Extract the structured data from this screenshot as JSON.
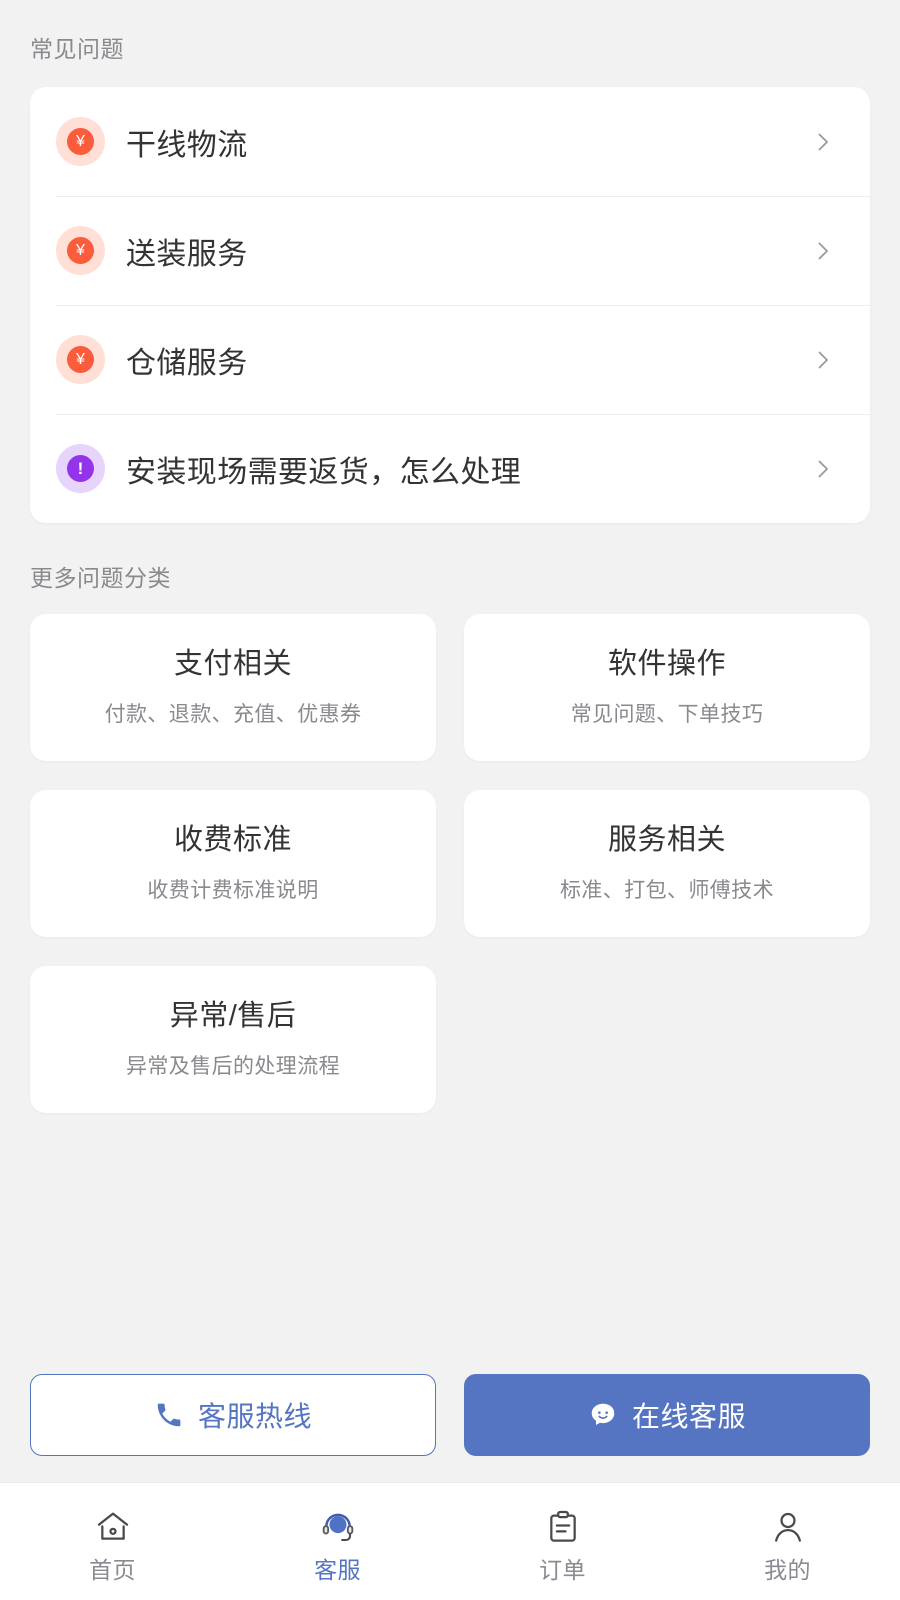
{
  "theme": {
    "page_bg": "#f2f2f3",
    "card_bg": "#ffffff",
    "accent_blue": "#5575c2",
    "money_icon_bg": "#ffdfd6",
    "money_icon_fg": "#fb5c3b",
    "alert_icon_bg": "#e6d4fb",
    "alert_icon_fg": "#9333ea",
    "title_color": "#333336",
    "muted_color": "#8a8a8e"
  },
  "faq_section": {
    "title": "常见问题",
    "items": [
      {
        "label": "干线物流",
        "icon": "yuan-currency-icon",
        "icon_glyph": "¥",
        "icon_kind": "money",
        "chevron": "chevron-right-icon"
      },
      {
        "label": "送装服务",
        "icon": "yuan-currency-icon",
        "icon_glyph": "¥",
        "icon_kind": "money",
        "chevron": "chevron-right-icon"
      },
      {
        "label": "仓储服务",
        "icon": "yuan-currency-icon",
        "icon_glyph": "¥",
        "icon_kind": "money",
        "chevron": "chevron-right-icon"
      },
      {
        "label": "安装现场需要返货，怎么处理",
        "icon": "exclamation-icon",
        "icon_glyph": "!",
        "icon_kind": "alert",
        "chevron": "chevron-right-icon"
      }
    ]
  },
  "categories_section": {
    "title": "更多问题分类",
    "items": [
      {
        "title": "支付相关",
        "subtitle": "付款、退款、充值、优惠券"
      },
      {
        "title": "软件操作",
        "subtitle": "常见问题、下单技巧"
      },
      {
        "title": "收费标准",
        "subtitle": "收费计费标准说明"
      },
      {
        "title": "服务相关",
        "subtitle": "标准、打包、师傅技术"
      },
      {
        "title": "异常/售后",
        "subtitle": "异常及售后的处理流程"
      }
    ]
  },
  "actions": {
    "hotline": {
      "label": "客服热线",
      "icon": "phone-icon"
    },
    "online": {
      "label": "在线客服",
      "icon": "chat-smiley-icon"
    }
  },
  "tabbar": {
    "items": [
      {
        "label": "首页",
        "icon": "home-icon",
        "active": false
      },
      {
        "label": "客服",
        "icon": "headset-icon",
        "active": true
      },
      {
        "label": "订单",
        "icon": "clipboard-icon",
        "active": false
      },
      {
        "label": "我的",
        "icon": "person-icon",
        "active": false
      }
    ]
  }
}
